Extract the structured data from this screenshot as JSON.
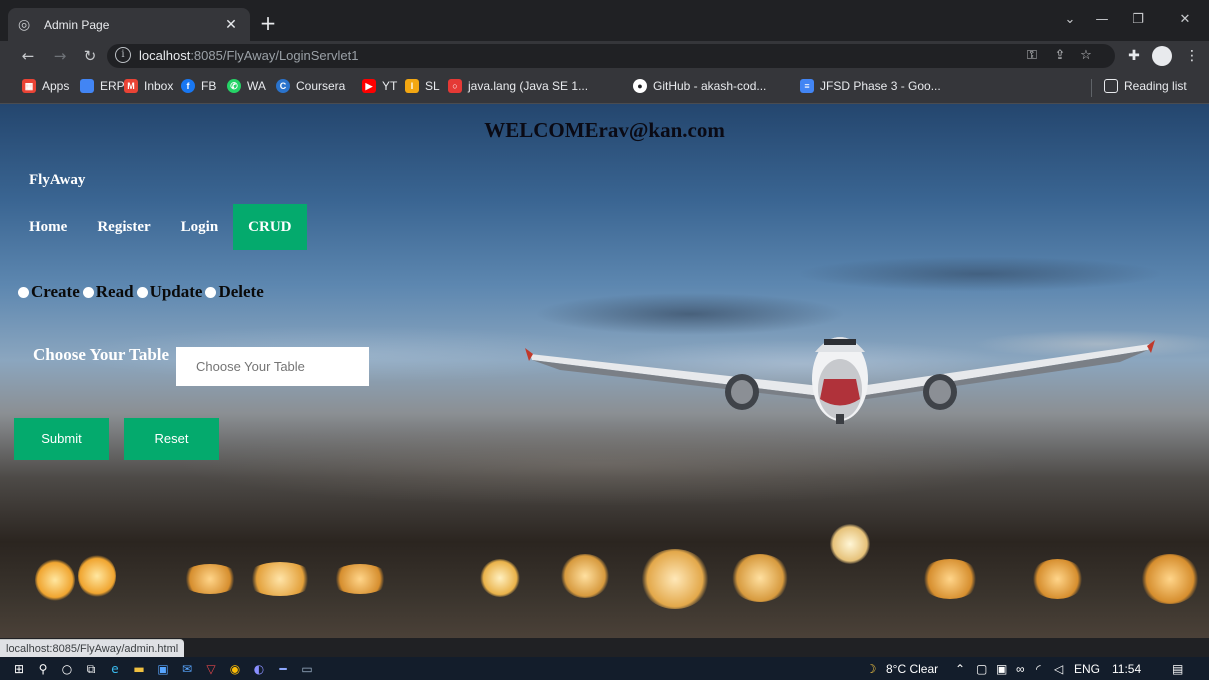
{
  "browser": {
    "tab_title": "Admin Page",
    "url_host": "localhost",
    "url_rest": ":8085/FlyAway/LoginServlet1",
    "bookmarks": [
      {
        "label": "Apps",
        "icon": "apps-grid-icon",
        "color": "#ea4335"
      },
      {
        "label": "ERP",
        "icon": "erp-icon",
        "color": "#4285f4"
      },
      {
        "label": "Inbox",
        "icon": "gmail-icon",
        "color": "#ea4335"
      },
      {
        "label": "FB",
        "icon": "facebook-icon",
        "color": "#1877f2"
      },
      {
        "label": "WA",
        "icon": "whatsapp-icon",
        "color": "#25d366"
      },
      {
        "label": "Coursera",
        "icon": "coursera-icon",
        "color": "#2a73cc"
      },
      {
        "label": "YT",
        "icon": "youtube-icon",
        "color": "#ff0000"
      },
      {
        "label": "SL",
        "icon": "simplilearn-icon",
        "color": "#f3a712"
      },
      {
        "label": "java.lang (Java SE 1...",
        "icon": "oracle-icon",
        "color": "#e53935"
      },
      {
        "label": "GitHub - akash-cod...",
        "icon": "github-icon",
        "color": "#ffffff"
      },
      {
        "label": "JFSD Phase 3 - Goo...",
        "icon": "google-docs-icon",
        "color": "#4285f4"
      }
    ],
    "reading_list": "Reading list",
    "status_url": "localhost:8085/FlyAway/admin.html"
  },
  "page": {
    "welcome": "WELCOMErav@kan.com",
    "brand": "FlyAway",
    "nav": [
      "Home",
      "Register",
      "Login",
      "CRUD"
    ],
    "active_nav": "CRUD",
    "operations": [
      "Create",
      "Read",
      "Update",
      "Delete"
    ],
    "table_label": "Choose Your Table",
    "table_placeholder": "Choose Your Table",
    "submit_label": "Submit",
    "reset_label": "Reset",
    "accent_color": "#04aa6d"
  },
  "taskbar": {
    "weather": "8°C Clear",
    "language": "ENG",
    "time": "11:54"
  }
}
